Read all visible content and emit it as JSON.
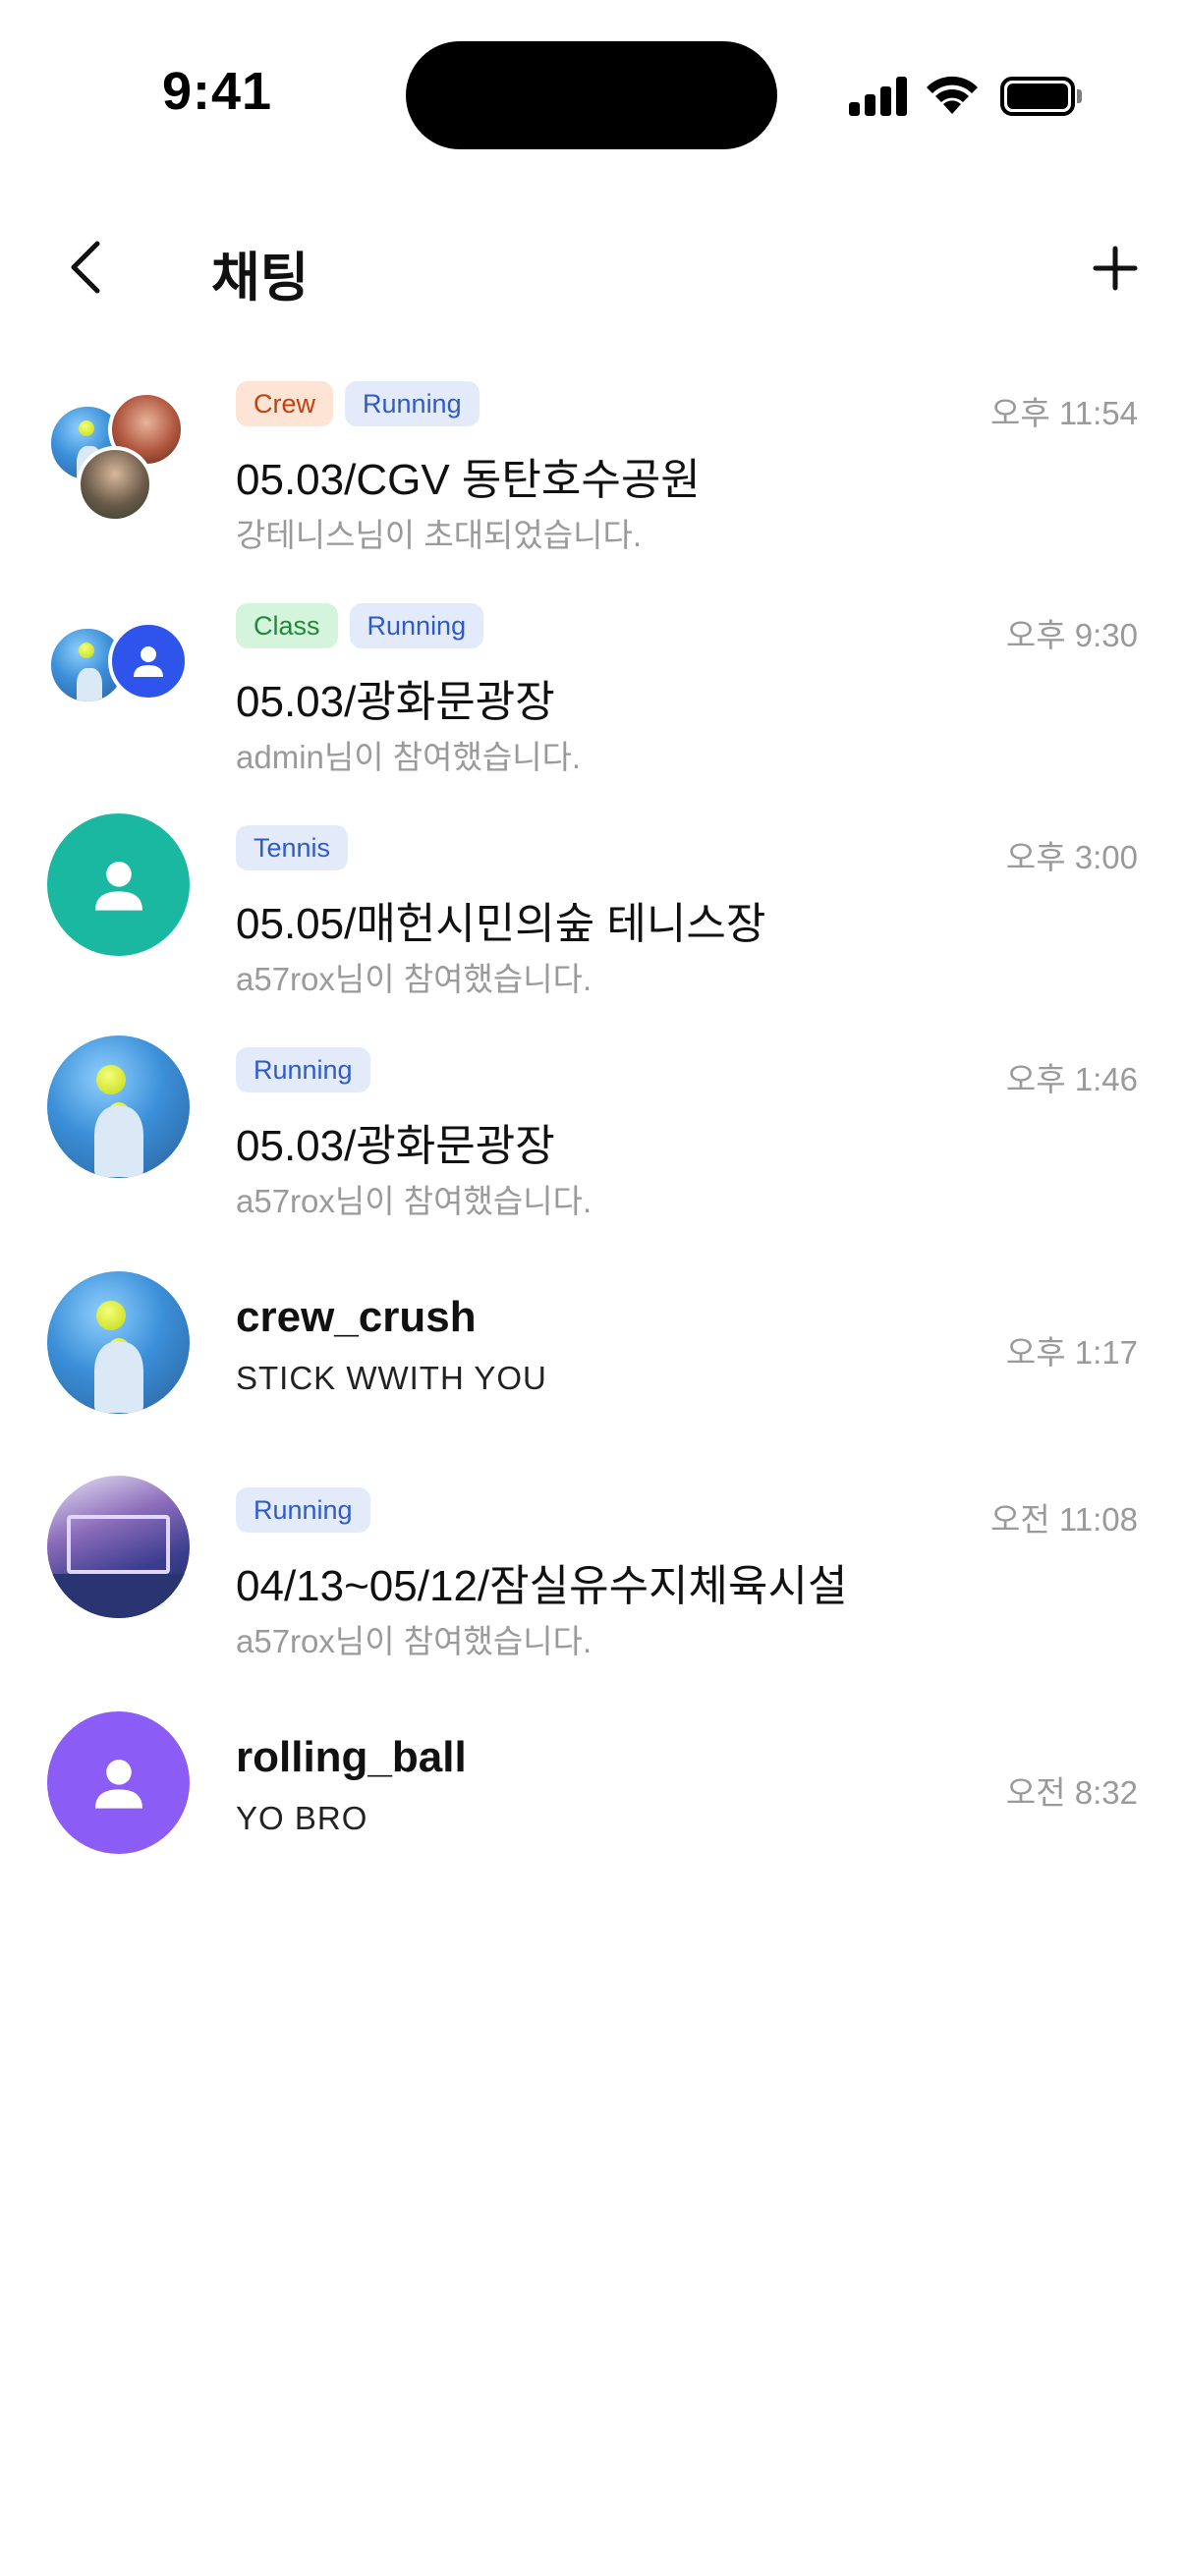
{
  "status_bar": {
    "time": "9:41"
  },
  "header": {
    "title": "채팅"
  },
  "chats": [
    {
      "tags": [
        "Crew",
        "Running"
      ],
      "title": "05.03/CGV 동탄호수공원",
      "message": "강테니스님이 초대되었습니다.",
      "time": "오후 11:54"
    },
    {
      "tags": [
        "Class",
        "Running"
      ],
      "title": "05.03/광화문광장",
      "message": "admin님이 참여했습니다.",
      "time": "오후 9:30"
    },
    {
      "tags": [
        "Tennis"
      ],
      "title": "05.05/매헌시민의숲 테니스장",
      "message": "a57rox님이 참여했습니다.",
      "time": "오후 3:00"
    },
    {
      "tags": [
        "Running"
      ],
      "title": "05.03/광화문광장",
      "message": "a57rox님이 참여했습니다.",
      "time": "오후 1:46"
    },
    {
      "tags": [],
      "title": "crew_crush",
      "message": "STICK WWITH YOU",
      "time": "오후 1:17"
    },
    {
      "tags": [
        "Running"
      ],
      "title": "04/13~05/12/잠실유수지체육시설",
      "message": "a57rox님이 참여했습니다.",
      "time": "오전 11:08"
    },
    {
      "tags": [],
      "title": "rolling_ball",
      "message": "YO BRO",
      "time": "오전 8:32"
    }
  ]
}
